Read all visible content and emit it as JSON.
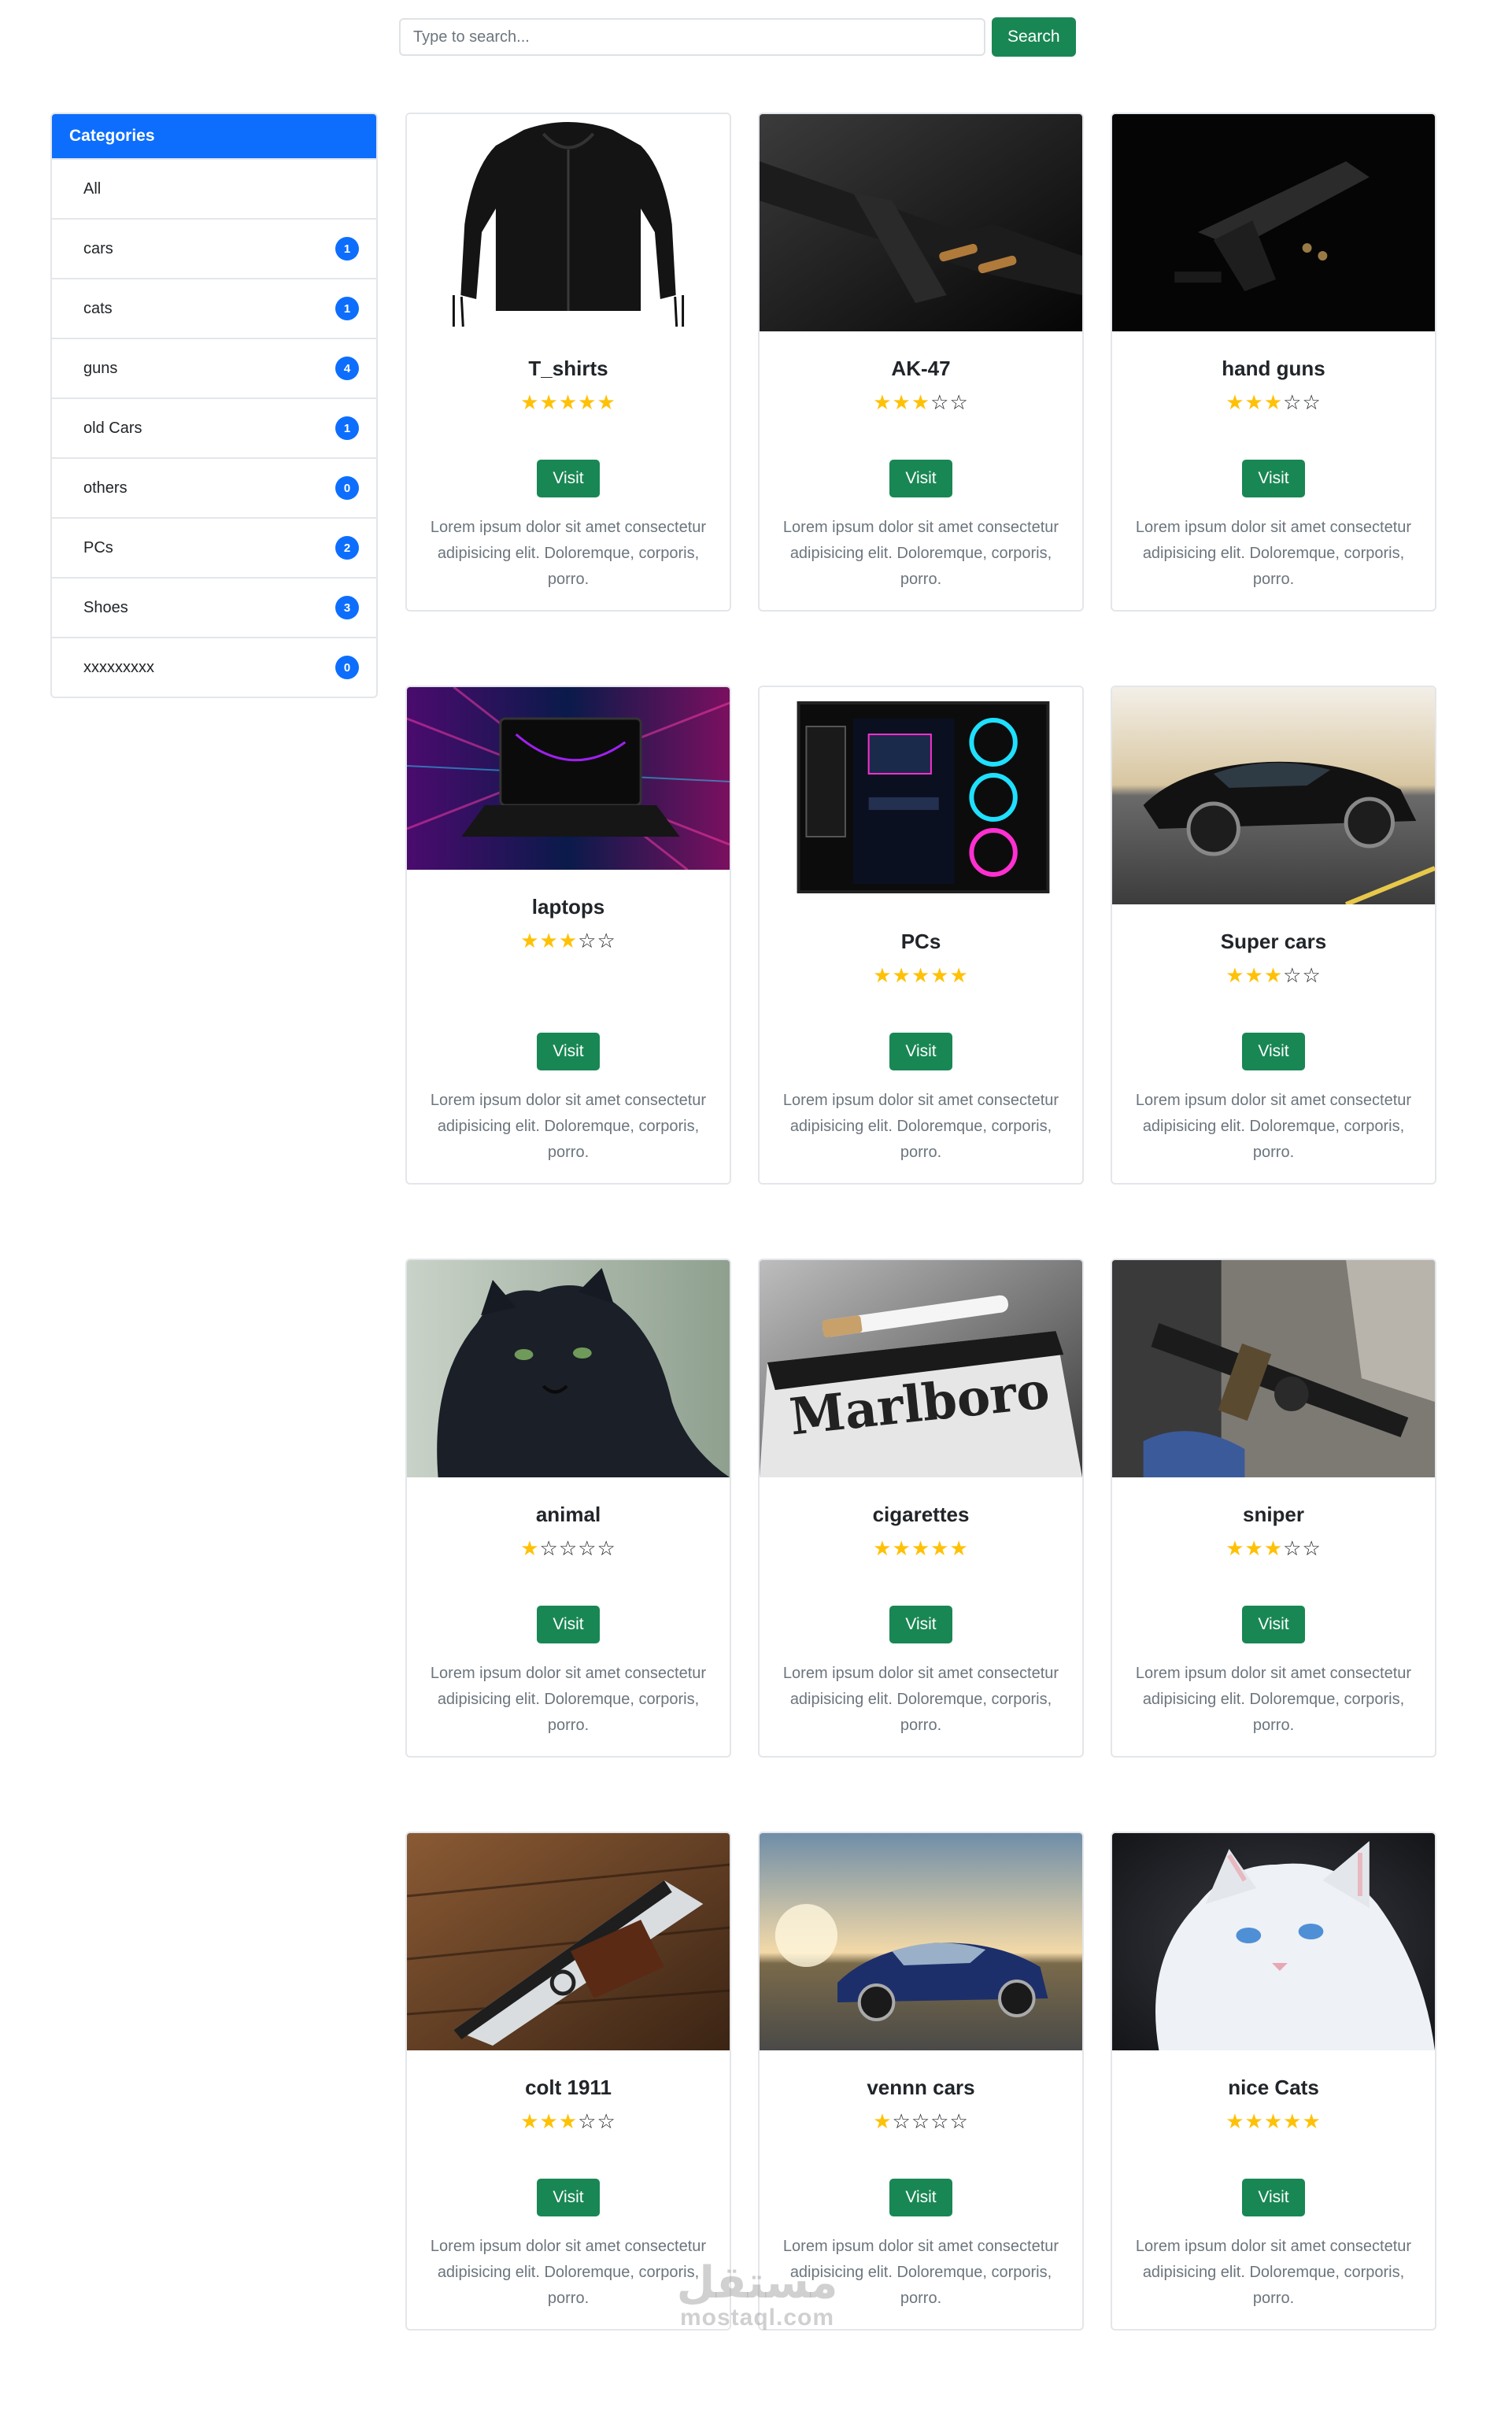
{
  "search": {
    "placeholder": "Type to search...",
    "button_label": "Search"
  },
  "sidebar": {
    "title": "Categories",
    "items": [
      {
        "label": "All",
        "count": ""
      },
      {
        "label": "cars",
        "count": "1"
      },
      {
        "label": "cats",
        "count": "1"
      },
      {
        "label": "guns",
        "count": "4"
      },
      {
        "label": "old Cars",
        "count": "1"
      },
      {
        "label": "others",
        "count": "0"
      },
      {
        "label": "PCs",
        "count": "2"
      },
      {
        "label": "Shoes",
        "count": "3"
      },
      {
        "label": "xxxxxxxxx",
        "count": "0"
      }
    ]
  },
  "products": [
    {
      "title": "T_shirts",
      "rating": 5,
      "button_label": "Visit",
      "description": "Lorem ipsum dolor sit amet consectetur adipisicing elit. Doloremque, corporis, porro.",
      "image": "black hoodie"
    },
    {
      "title": "AK-47",
      "rating": 3,
      "button_label": "Visit",
      "description": "Lorem ipsum dolor sit amet consectetur adipisicing elit. Doloremque, corporis, porro.",
      "image": "rifle with bullets"
    },
    {
      "title": "hand guns",
      "rating": 3,
      "button_label": "Visit",
      "description": "Lorem ipsum dolor sit amet consectetur adipisicing elit. Doloremque, corporis, porro.",
      "image": "pistol on black"
    },
    {
      "title": "laptops",
      "rating": 3,
      "button_label": "Visit",
      "description": "Lorem ipsum dolor sit amet consectetur adipisicing elit. Doloremque, corporis, porro.",
      "image": "gaming laptop"
    },
    {
      "title": "PCs",
      "rating": 5,
      "button_label": "Visit",
      "description": "Lorem ipsum dolor sit amet consectetur adipisicing elit. Doloremque, corporis, porro.",
      "image": "rgb pc case"
    },
    {
      "title": "Super cars",
      "rating": 3,
      "button_label": "Visit",
      "description": "Lorem ipsum dolor sit amet consectetur adipisicing elit. Doloremque, corporis, porro.",
      "image": "black supercar"
    },
    {
      "title": "animal",
      "rating": 1,
      "button_label": "Visit",
      "description": "Lorem ipsum dolor sit amet consectetur adipisicing elit. Doloremque, corporis, porro.",
      "image": "black panther"
    },
    {
      "title": "cigarettes",
      "rating": 5,
      "button_label": "Visit",
      "description": "Lorem ipsum dolor sit amet consectetur adipisicing elit. Doloremque, corporis, porro.",
      "image": "cigarette pack",
      "image_text": "Marlboro"
    },
    {
      "title": "sniper",
      "rating": 3,
      "button_label": "Visit",
      "description": "Lorem ipsum dolor sit amet consectetur adipisicing elit. Doloremque, corporis, porro.",
      "image": "rifle in car"
    },
    {
      "title": "colt 1911",
      "rating": 3,
      "button_label": "Visit",
      "description": "Lorem ipsum dolor sit amet consectetur adipisicing elit. Doloremque, corporis, porro.",
      "image": "colt pistol on wood"
    },
    {
      "title": "vennn cars",
      "rating": 1,
      "button_label": "Visit",
      "description": "Lorem ipsum dolor sit amet consectetur adipisicing elit. Doloremque, corporis, porro.",
      "image": "classic blue car"
    },
    {
      "title": "nice Cats",
      "rating": 5,
      "button_label": "Visit",
      "description": "Lorem ipsum dolor sit amet consectetur adipisicing elit. Doloremque, corporis, porro.",
      "image": "white cat"
    }
  ],
  "watermark": {
    "arabic": "مستقل",
    "latin": "mostaql.com"
  },
  "colors": {
    "primary": "#0d6efd",
    "success": "#198754",
    "star": "#ffc107",
    "muted": "#6c757d"
  }
}
